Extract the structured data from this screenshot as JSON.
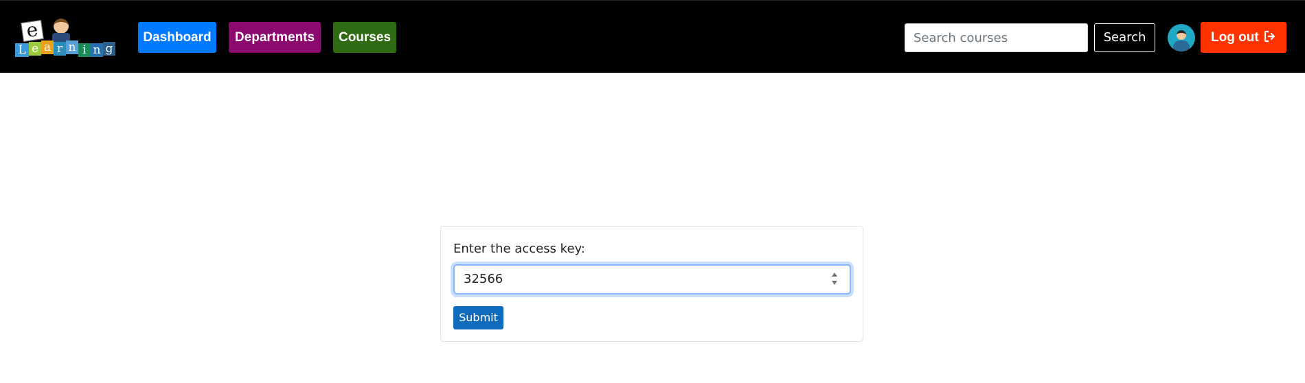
{
  "navbar": {
    "logo": {
      "letters": [
        "L",
        "e",
        "a",
        "r",
        "n",
        "i",
        "n",
        "g"
      ],
      "big_letter": "e"
    },
    "nav": {
      "dashboard": "Dashboard",
      "departments": "Departments",
      "courses": "Courses"
    },
    "search": {
      "placeholder": "Search courses",
      "value": "",
      "button": "Search"
    },
    "logout": "Log out",
    "icons": {
      "avatar": "user-avatar-icon",
      "logout": "sign-out-icon"
    }
  },
  "access_form": {
    "label": "Enter the access key:",
    "value": "32566",
    "submit": "Submit"
  },
  "colors": {
    "navbar_bg": "#000000",
    "dashboard": "#007bff",
    "departments": "#8a0a6e",
    "courses": "#2e6b12",
    "logout": "#ff3300",
    "submit": "#0f6cbd"
  }
}
